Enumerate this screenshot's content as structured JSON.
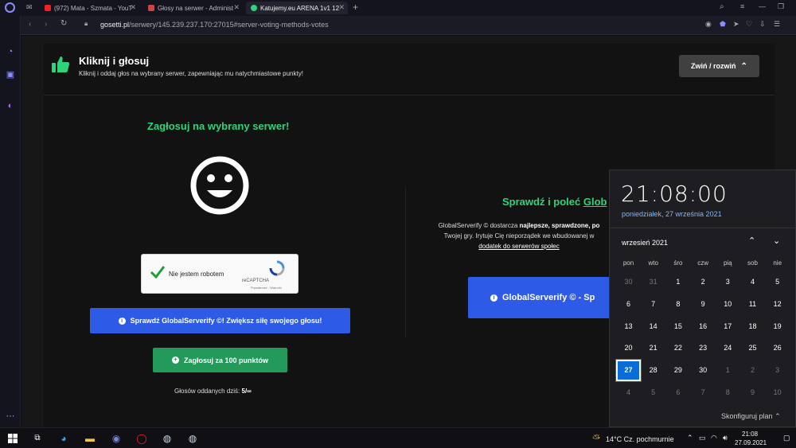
{
  "browser": {
    "tabs": [
      {
        "title": "(972) Mata - Szmata - YouT"
      },
      {
        "title": "Głosy na serwer - Administ"
      },
      {
        "title": "Katujemy.eu ARENA 1v1 12"
      }
    ],
    "url_domain": "gosetti.pl",
    "url_path": "/serwery/145.239.237.170:27015#server-voting-methods-votes"
  },
  "page": {
    "header": {
      "title": "Kliknij i głosuj",
      "subtitle": "Kliknij i oddaj głos na wybrany serwer, zapewniając mu natychmiastowe punkty!",
      "toggle_label": "Zwiń / rozwiń"
    },
    "vote": {
      "heading": "Zagłosuj na wybrany serwer!",
      "captcha_label": "Nie jestem robotem",
      "captcha_brand": "reCAPTCHA",
      "captcha_links": "Prywatność - Warunki",
      "check_button": "Sprawdź GlobalServerify ©! Zwiększ siłę swojego głosu!",
      "vote_button": "Zagłosuj za 100 punktów",
      "votes_today_label": "Głosów oddanych dziś:",
      "votes_today_value": "5/∞"
    },
    "promo": {
      "heading_prefix": "Sprawdź i poleć",
      "heading_link": "Glob",
      "line1_prefix": "GlobalServerify © dostarcza",
      "line1_bold": "najlepsze, sprawdzone, po",
      "line2": "Twojej gry. Irytuje Cię nieporządek we wbudowanej w",
      "line3_link": "dodatek do serwerów społec",
      "button": "GlobalServerify © - Sp"
    }
  },
  "calendar": {
    "time": "21:08:00",
    "date_long": "poniedziałek, 27 września 2021",
    "month": "wrzesień 2021",
    "weekdays": [
      "pon",
      "wto",
      "śro",
      "czw",
      "pią",
      "sob",
      "nie"
    ],
    "weeks": [
      [
        "30",
        "31",
        "1",
        "2",
        "3",
        "4",
        "5"
      ],
      [
        "6",
        "7",
        "8",
        "9",
        "10",
        "11",
        "12"
      ],
      [
        "13",
        "14",
        "15",
        "16",
        "17",
        "18",
        "19"
      ],
      [
        "20",
        "21",
        "22",
        "23",
        "24",
        "25",
        "26"
      ],
      [
        "27",
        "28",
        "29",
        "30",
        "1",
        "2",
        "3"
      ],
      [
        "4",
        "5",
        "6",
        "7",
        "8",
        "9",
        "10"
      ]
    ],
    "today": "27",
    "configure_label": "Skonfiguruj plan"
  },
  "taskbar": {
    "weather": "14°C  Cz. pochmurnie",
    "time": "21:08",
    "date": "27.09.2021"
  },
  "colors": {
    "accent_green": "#2ed47a",
    "button_blue": "#2e5be6",
    "button_green": "#23995a",
    "calendar_today": "#0a6cd6"
  }
}
